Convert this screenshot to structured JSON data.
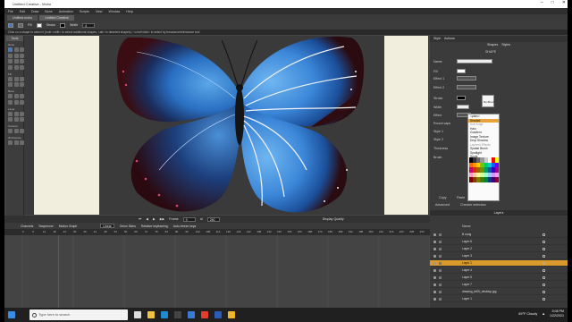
{
  "app": {
    "title": "Untitled Creative - Moho",
    "window_controls": [
      "–",
      "□",
      "✕"
    ]
  },
  "menu": [
    "File",
    "Edit",
    "Draw",
    "Bone",
    "Animation",
    "Scripts",
    "View",
    "Window",
    "Help"
  ],
  "doc_tabs": [
    "Untitled.moho",
    "Untitled Creative"
  ],
  "tool_options": {
    "fill_label": "Fill",
    "stroke_label": "Stroke",
    "width_label": "Width",
    "width_value": "4"
  },
  "hint": "Click on a shape to select it (hold <shift> to select additional shapes, <alt> to deselect shapes) / <cmd+click> to select by breadcrumb/instance tool",
  "toolbox": {
    "title": "Tools",
    "sections": [
      "Draw",
      "Fill",
      "Bone",
      "Layer",
      "Camera",
      "Workspace"
    ]
  },
  "playback": {
    "frame_label": "Frame",
    "frame_value": "0",
    "of_label": "of",
    "total": "240",
    "quality_label": "Display Quality"
  },
  "timeline": {
    "tabs": [
      "Channels",
      "Sequencer",
      "Motion Graph"
    ],
    "interp": "Linear",
    "onion": "Onion Skins",
    "relative": "Relative keyframing",
    "autofreeze": "Auto-freeze keys",
    "ruler": [
      "0",
      "6",
      "12",
      "18",
      "24",
      "30",
      "36",
      "42",
      "48",
      "54",
      "60",
      "66",
      "72",
      "78",
      "84",
      "90",
      "96",
      "102",
      "108",
      "114",
      "120",
      "126",
      "132",
      "138",
      "144",
      "150",
      "156",
      "162",
      "168",
      "174",
      "180",
      "186",
      "192",
      "198",
      "204",
      "210",
      "216",
      "222",
      "228",
      "234"
    ]
  },
  "style_panel": {
    "tabs": [
      "Style",
      "Actions"
    ],
    "sub_tabs": [
      "Shapes",
      "Styles"
    ],
    "section": "SHAPE",
    "name_label": "Name",
    "fill_label": "Fill",
    "stroke_label": "Stroke",
    "effect1": "Effect 1",
    "effect2": "Effect 2",
    "effect_none": "<none>",
    "width_label": "Width",
    "effect_label": "Effect",
    "round_caps": "Round caps",
    "style1": "Style 1",
    "style2": "Style 2",
    "thickness": "Thickness",
    "brush": "Brush",
    "copy": "Copy",
    "paste": "Paste",
    "reset": "Reset",
    "advanced": "Advanced",
    "checker": "Checker selection",
    "no_brush": "No Brush"
  },
  "effect_menu": {
    "items": [
      "<plain>",
      "Shaded",
      "Soft Edge",
      "Halo",
      "Gradient",
      "Image Texture",
      "Drop Shadow",
      "Layered Effects",
      "Spatial Brush",
      "Spotlight",
      "Spots",
      "Sketchy",
      "Angled Pen"
    ],
    "highlighted": 1
  },
  "palette_colors": [
    "#000000",
    "#333333",
    "#666666",
    "#999999",
    "#cccccc",
    "#ffffff",
    "#ff0000",
    "#ffff00",
    "#ff6600",
    "#ff9900",
    "#ffcc00",
    "#66cc00",
    "#00cc66",
    "#00cccc",
    "#0066ff",
    "#6600ff",
    "#cc0066",
    "#cc3300",
    "#996600",
    "#669900",
    "#009966",
    "#006699",
    "#3300cc",
    "#990099",
    "#ff99cc",
    "#ffcc99",
    "#ffff99",
    "#ccff99",
    "#99ffcc",
    "#99ccff",
    "#cc99ff",
    "#ff99ff",
    "#800000",
    "#804000",
    "#808000",
    "#408000",
    "#008040",
    "#004080",
    "#400080",
    "#800040"
  ],
  "layers_panel": {
    "title": "Layers",
    "name_header": "Name",
    "rows": [
      {
        "name": "B song",
        "sel": false
      },
      {
        "name": "Layer 6",
        "sel": false
      },
      {
        "name": "Layer 2",
        "sel": false
      },
      {
        "name": "Layer 3",
        "sel": false
      },
      {
        "name": "Layer 1",
        "sel": true
      },
      {
        "name": "Layer 4",
        "sel": false
      },
      {
        "name": "Layer 5",
        "sel": false
      },
      {
        "name": "Layer 7",
        "sel": false
      },
      {
        "name": "drawing_bt09_desktop.jpg",
        "sel": false
      },
      {
        "name": "Layer 1",
        "sel": false
      }
    ]
  },
  "taskbar": {
    "search": "Type here to search",
    "weather": "69°F Cloudy",
    "time": "5:08 PM",
    "date": "1/22/2021"
  }
}
